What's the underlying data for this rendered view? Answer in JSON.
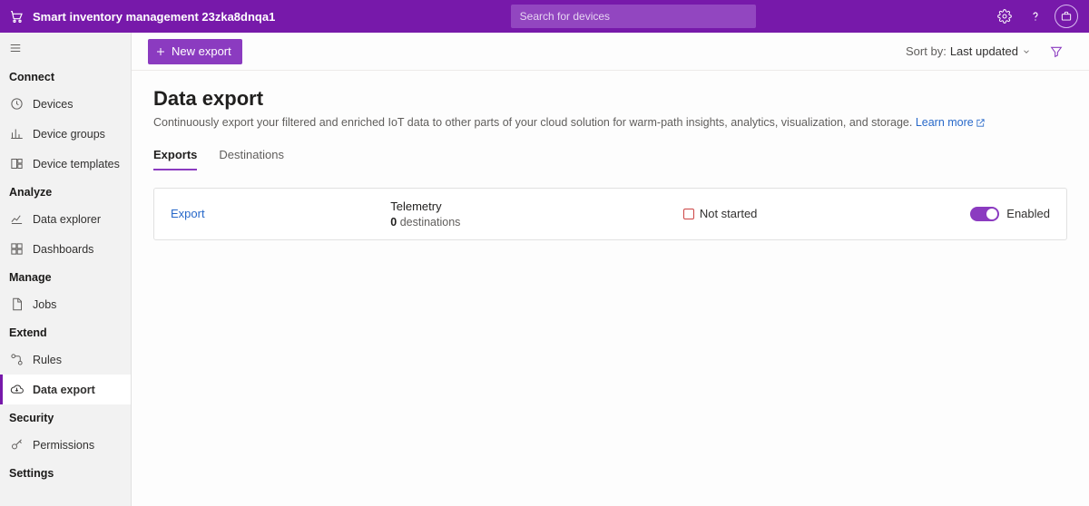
{
  "colors": {
    "brand": "#7719aa",
    "accent": "#8b3bc0",
    "link": "#2768c9"
  },
  "topbar": {
    "appTitle": "Smart inventory management 23zka8dnqa1",
    "searchPlaceholder": "Search for devices"
  },
  "sidebar": {
    "groups": [
      {
        "label": "Connect",
        "items": [
          {
            "id": "devices",
            "label": "Devices",
            "icon": "clock"
          },
          {
            "id": "device-groups",
            "label": "Device groups",
            "icon": "bar-chart"
          },
          {
            "id": "device-templates",
            "label": "Device templates",
            "icon": "template"
          }
        ]
      },
      {
        "label": "Analyze",
        "items": [
          {
            "id": "data-explorer",
            "label": "Data explorer",
            "icon": "line-chart"
          },
          {
            "id": "dashboards",
            "label": "Dashboards",
            "icon": "grid"
          }
        ]
      },
      {
        "label": "Manage",
        "items": [
          {
            "id": "jobs",
            "label": "Jobs",
            "icon": "page"
          }
        ]
      },
      {
        "label": "Extend",
        "items": [
          {
            "id": "rules",
            "label": "Rules",
            "icon": "flow"
          },
          {
            "id": "data-export",
            "label": "Data export",
            "icon": "cloud-arrow",
            "active": true
          }
        ]
      },
      {
        "label": "Security",
        "items": [
          {
            "id": "permissions",
            "label": "Permissions",
            "icon": "key"
          }
        ]
      },
      {
        "label": "Settings",
        "items": []
      }
    ]
  },
  "toolbar": {
    "newExport": "New export",
    "sortByLabel": "Sort by:",
    "sortByValue": "Last updated"
  },
  "page": {
    "title": "Data export",
    "description": "Continuously export your filtered and enriched IoT data to other parts of your cloud solution for warm-path insights, analytics, visualization, and storage.",
    "learnMore": "Learn more"
  },
  "tabs": [
    {
      "id": "exports",
      "label": "Exports",
      "active": true
    },
    {
      "id": "destinations",
      "label": "Destinations",
      "active": false
    }
  ],
  "exports": [
    {
      "name": "Export",
      "type": "Telemetry",
      "destinationsCount": "0",
      "destinationsSuffix": "destinations",
      "status": "Not started",
      "enabled": true,
      "enabledLabel": "Enabled"
    }
  ]
}
